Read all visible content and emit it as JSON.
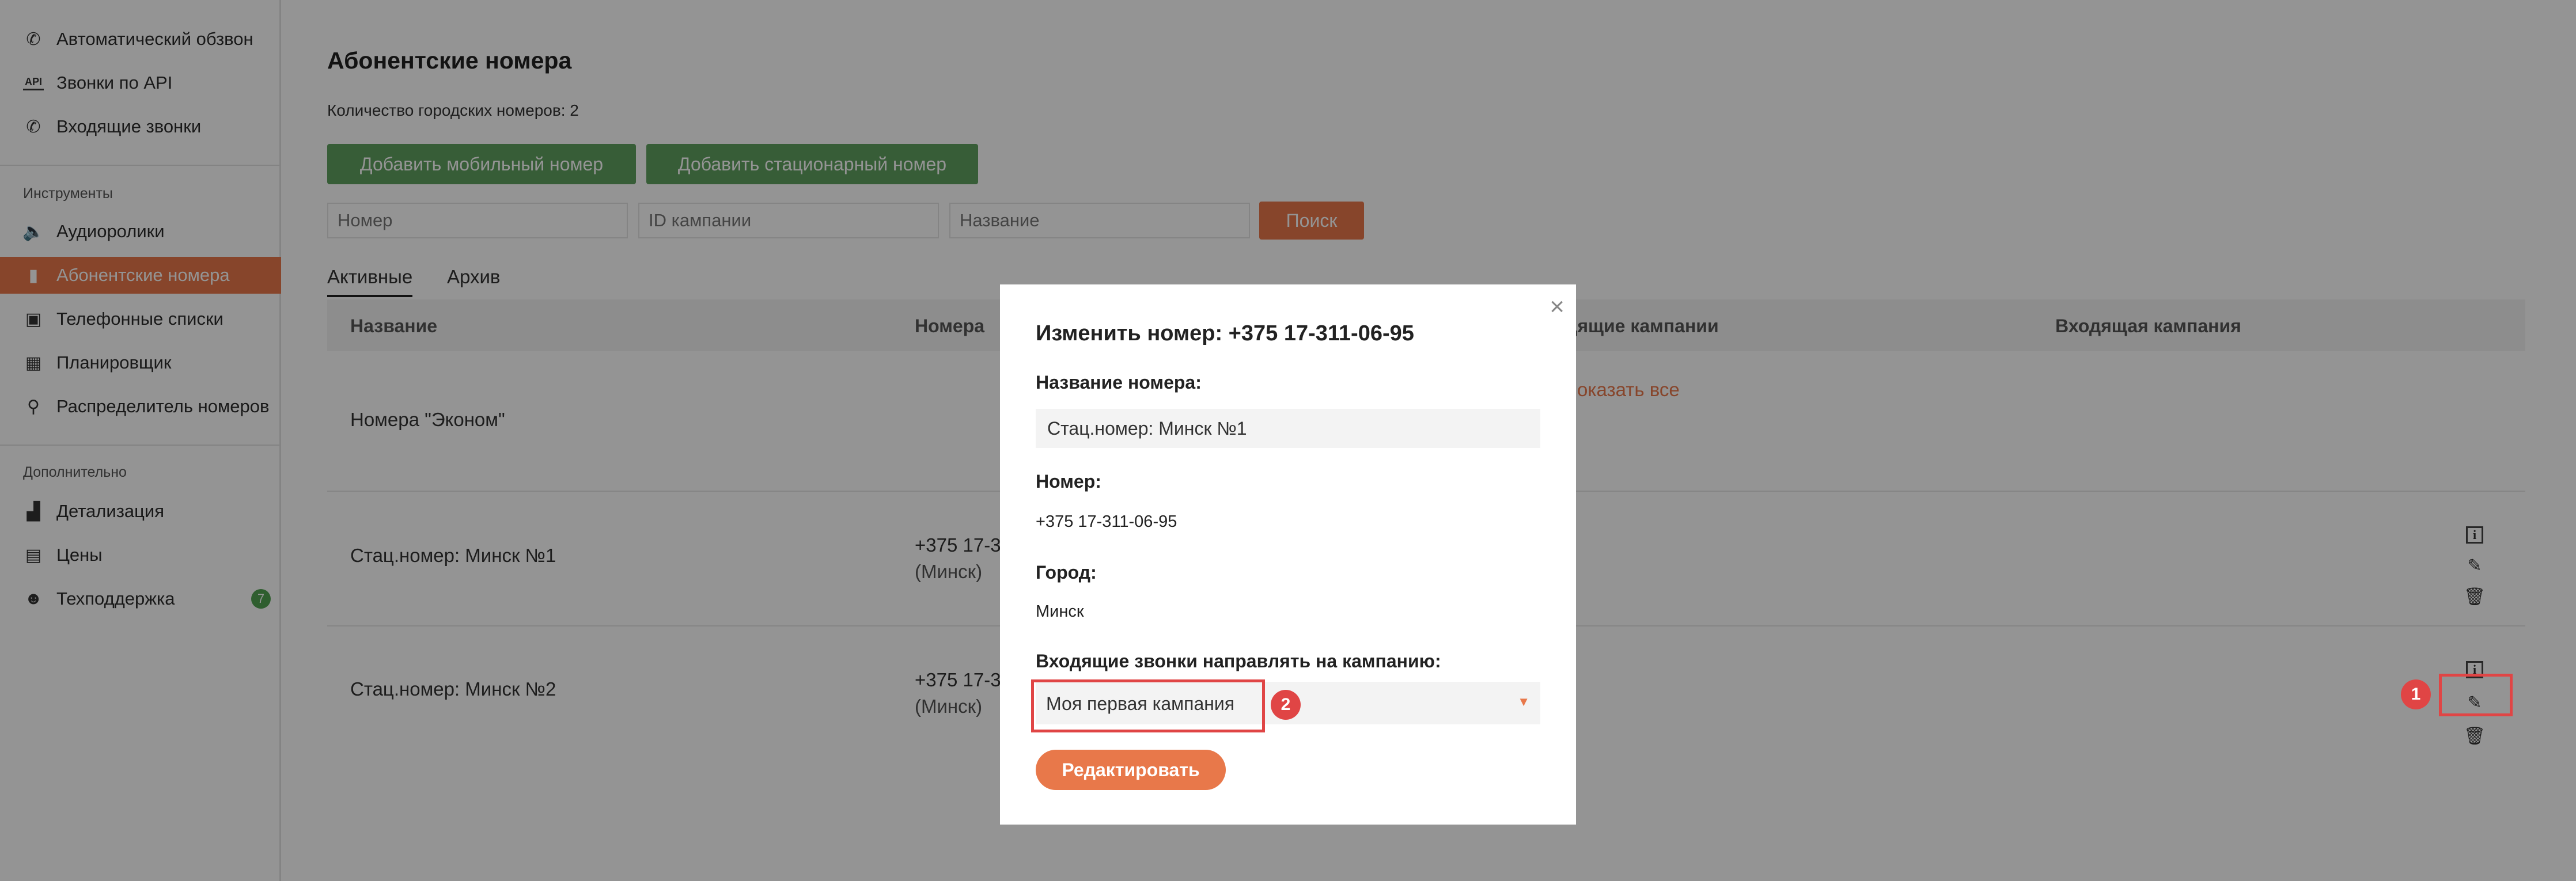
{
  "sidebar": {
    "items_top": [
      {
        "label": "Автоматический обзвон",
        "icon": "phone-icon"
      },
      {
        "label": "Звонки по API",
        "icon": "api-icon"
      },
      {
        "label": "Входящие звонки",
        "icon": "incoming-call-icon"
      }
    ],
    "section_tools": "Инструменты",
    "tools": [
      {
        "label": "Аудиоролики",
        "icon": "speaker-icon"
      },
      {
        "label": "Абонентские номера",
        "icon": "sim-icon",
        "active": true
      },
      {
        "label": "Телефонные списки",
        "icon": "phonebook-icon"
      },
      {
        "label": "Планировщик",
        "icon": "calendar-icon"
      },
      {
        "label": "Распределитель номеров",
        "icon": "distributor-icon"
      }
    ],
    "section_extra": "Дополнительно",
    "extra": [
      {
        "label": "Детализация",
        "icon": "chart-icon"
      },
      {
        "label": "Цены",
        "icon": "prices-icon"
      },
      {
        "label": "Техподдержка",
        "icon": "support-icon",
        "badge": "7"
      }
    ]
  },
  "main": {
    "title": "Абонентские номера",
    "count_text": "Количество городских номеров: 2",
    "btn_add_mobile": "Добавить мобильный номер",
    "btn_add_landline": "Добавить стационарный номер",
    "filters": {
      "number_placeholder": "Номер",
      "campaign_id_placeholder": "ID кампании",
      "name_placeholder": "Название",
      "search_label": "Поиск"
    },
    "tabs": [
      "Активные",
      "Архив"
    ],
    "table": {
      "headers": [
        "Название",
        "Номера",
        "дящие кампании",
        "Входящая кампания"
      ],
      "rows": [
        {
          "name": "Номера \"Эконом\"",
          "numbers": "",
          "city": "",
          "outgoing": "оказать все"
        },
        {
          "name": "Стац.номер: Минск №1",
          "numbers": "+375 17-3",
          "city": "(Минск)",
          "outgoing": ""
        },
        {
          "name": "Стац.номер: Минск №2",
          "numbers": "+375 17-3",
          "city": "(Минск)",
          "outgoing": ""
        }
      ]
    }
  },
  "markers": {
    "one": "1",
    "two": "2"
  },
  "modal": {
    "title": "Изменить номер: +375 17-311-06-95",
    "label_name": "Название номера:",
    "value_name": "Стац.номер: Минск №1",
    "label_number": "Номер:",
    "value_number": "+375 17-311-06-95",
    "label_city": "Город:",
    "value_city": "Минск",
    "label_campaign": "Входящие звонки направлять на кампанию:",
    "value_campaign": "Моя первая кампания",
    "submit_label": "Редактировать",
    "close_glyph": "×"
  },
  "colors": {
    "accent": "#e8784a",
    "green": "#5fa05f",
    "marker": "#e04545"
  }
}
